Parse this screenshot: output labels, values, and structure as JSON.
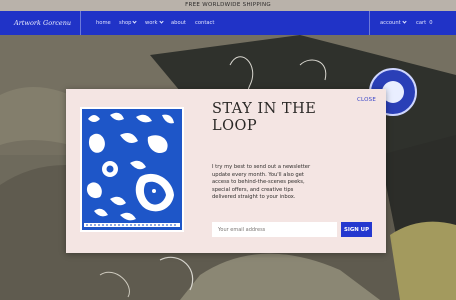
{
  "announcement": "FREE WORLDWIDE SHIPPING",
  "header": {
    "logo_text": "Artwork Gorcenu",
    "nav": [
      {
        "label": "home"
      },
      {
        "label": "shop"
      },
      {
        "label": "work"
      },
      {
        "label": "about"
      },
      {
        "label": "contact"
      }
    ],
    "account_label": "account",
    "cart_label": "cart",
    "cart_count": "0"
  },
  "modal": {
    "close_label": "CLOSE",
    "title_line1": "STAY IN THE",
    "title_line2": "LOOP",
    "body": "I try my best to send out a newsletter update every month. You'll also get access to behind-the-scenes peeks, special offers, and creative tips delivered straight to your inbox.",
    "email_placeholder": "Your email address",
    "signup_label": "SIGN UP"
  },
  "colors": {
    "brand_blue": "#2033c7",
    "modal_bg": "#f4e5e3",
    "announcement_bg": "#b9b2aa"
  }
}
